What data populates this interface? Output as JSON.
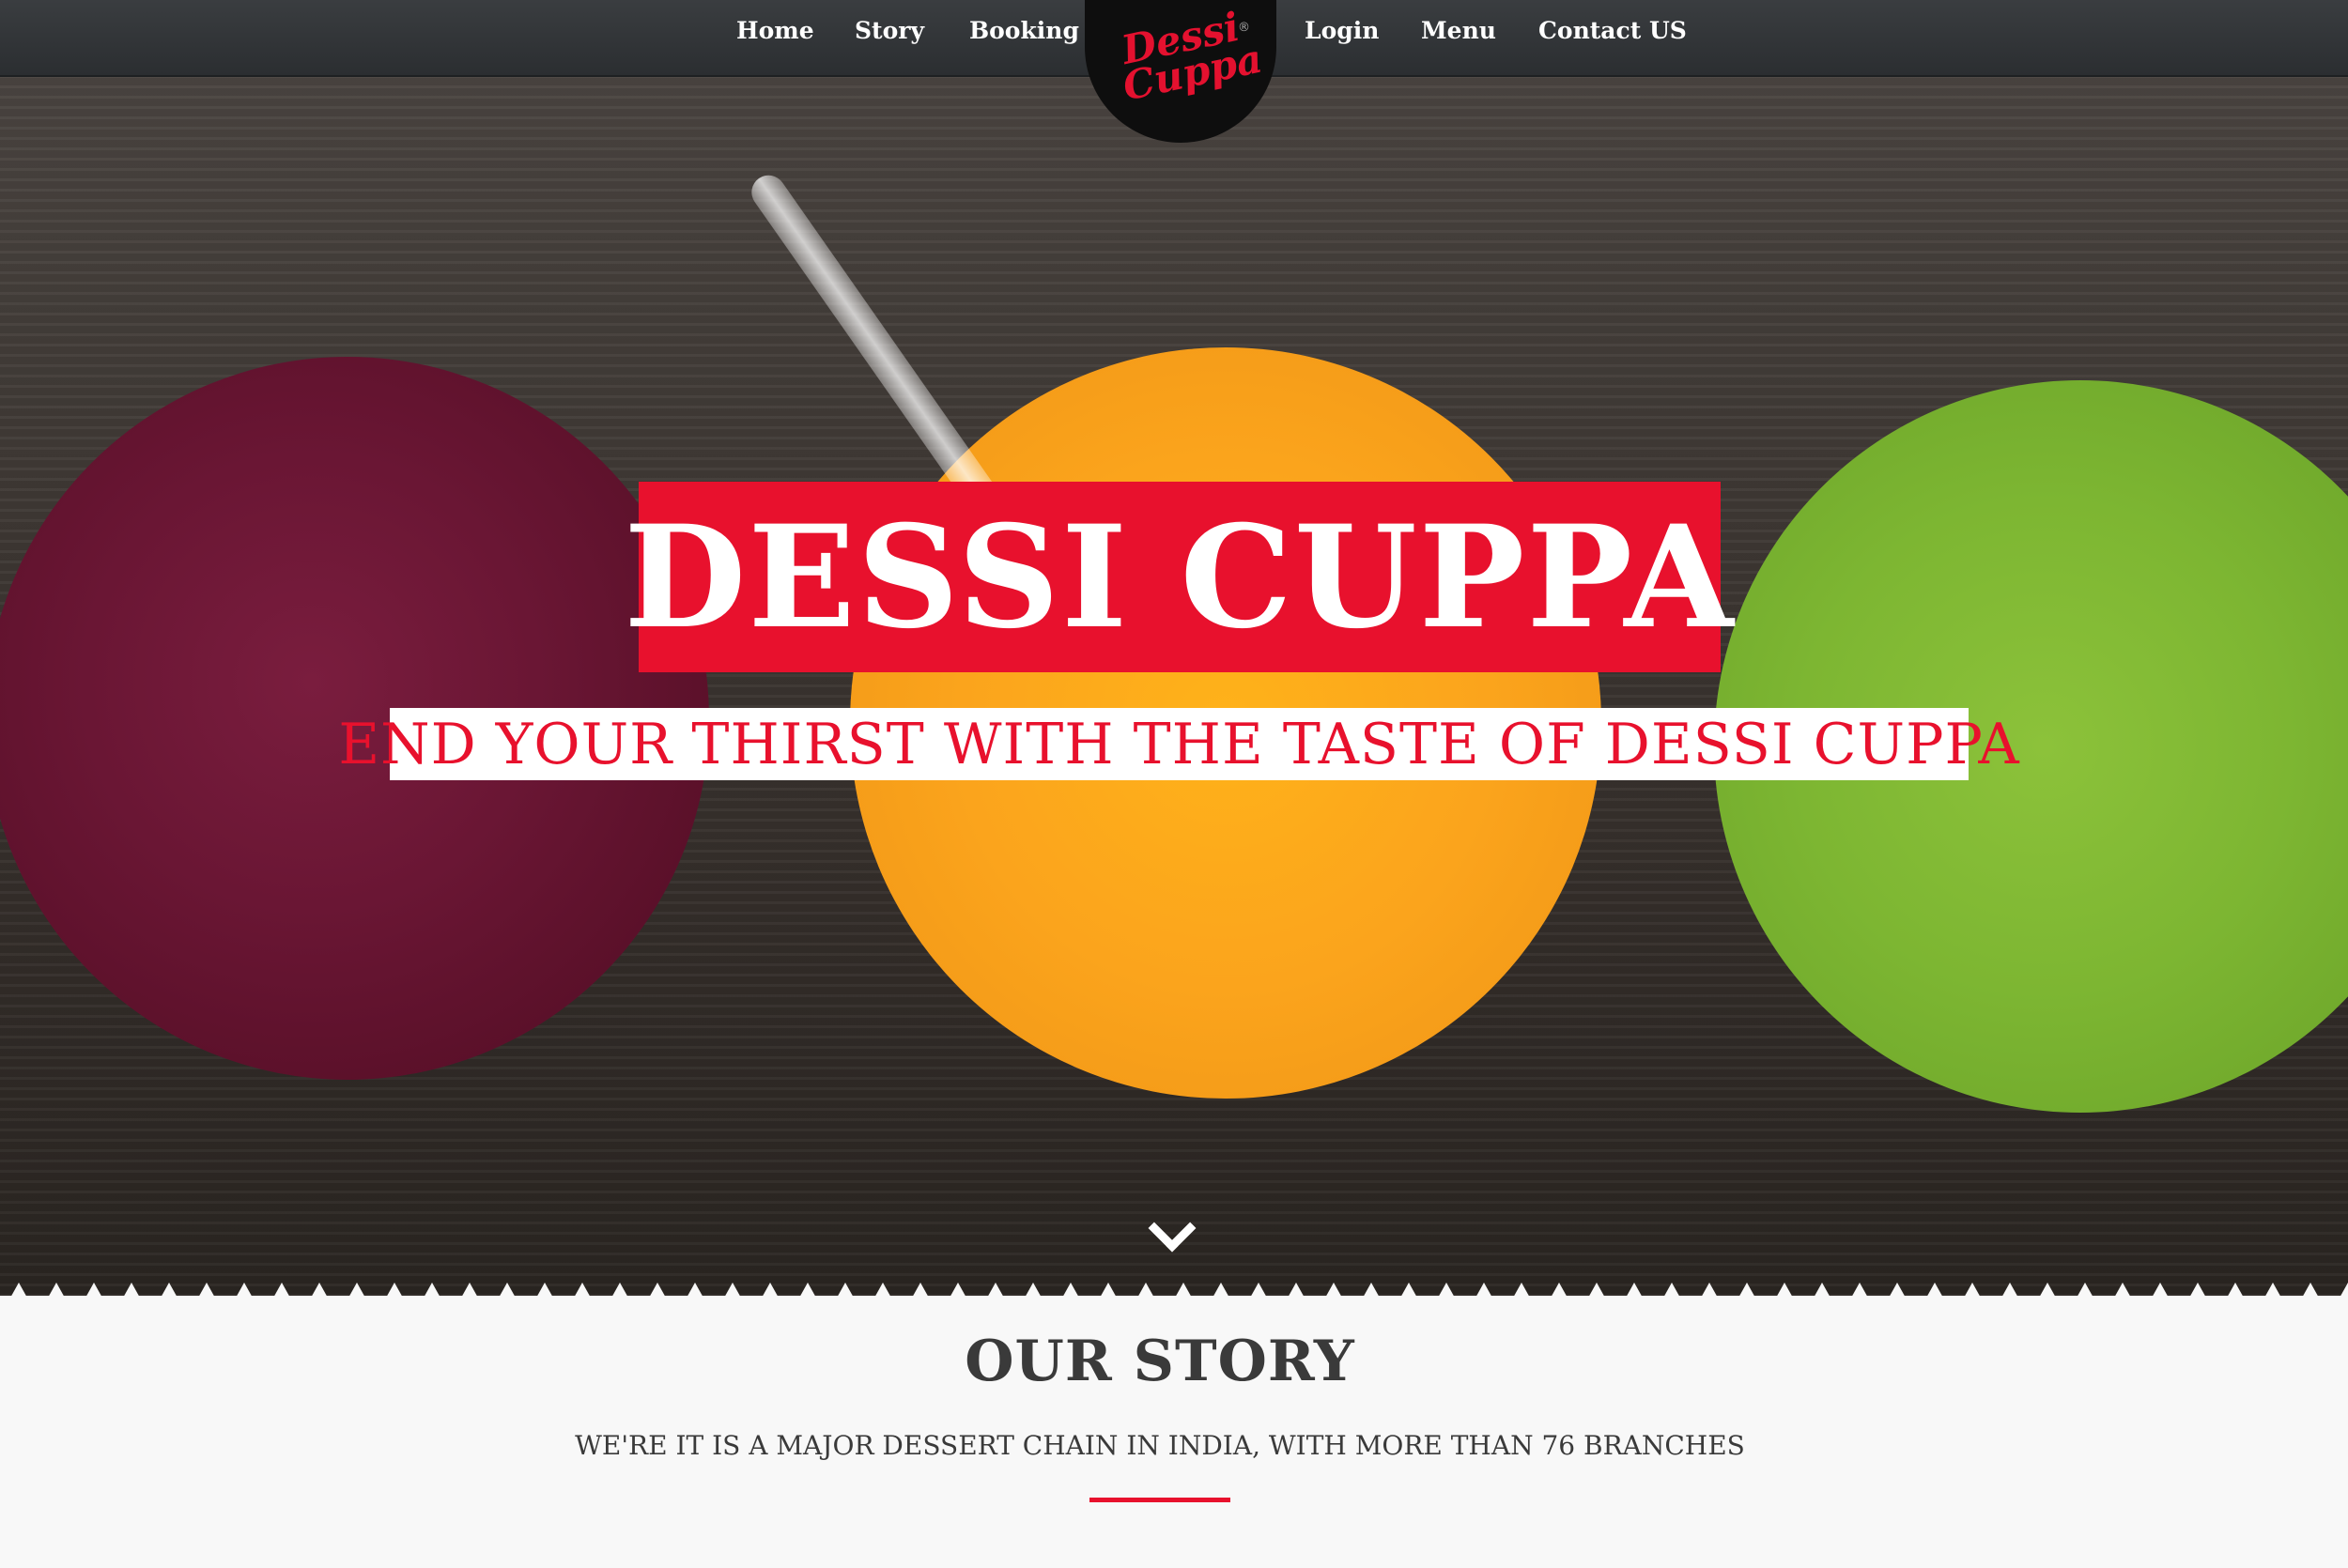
{
  "nav": {
    "items_left": [
      {
        "label": "Home"
      },
      {
        "label": "Story"
      },
      {
        "label": "Booking"
      }
    ],
    "items_right": [
      {
        "label": "Login"
      },
      {
        "label": "Menu"
      },
      {
        "label": "Contact US"
      }
    ],
    "logo": {
      "text": "Dessi Cuppa",
      "registered_mark": "®"
    }
  },
  "hero": {
    "title": "DESSI CUPPA",
    "subtitle": "END YOUR THIRST WITH THE TASTE OF DESSI CUPPA",
    "scroll_icon": "chevron-down-icon"
  },
  "story": {
    "heading": "OUR STORY",
    "text": "WE'RE IT IS A MAJOR DESSERT CHAIN IN INDIA, WITH MORE THAN 76 BRANCHES"
  },
  "colors": {
    "accent": "#e8112d",
    "nav_bg": "#2f3235",
    "section_bg": "#f8f8f8",
    "heading_text": "#3a3a3a"
  }
}
